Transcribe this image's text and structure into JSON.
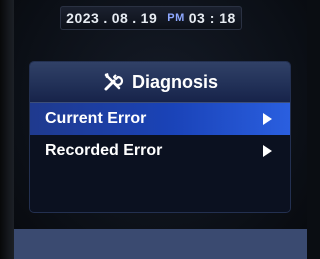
{
  "status_bar": {
    "year": "2023",
    "month": "08",
    "day": "19",
    "ampm": "PM",
    "time": "03 : 18",
    "separator": "."
  },
  "diagnosis_menu": {
    "title": "Diagnosis",
    "title_icon": "tools-icon",
    "items": [
      {
        "label": "Current Error",
        "selected": true,
        "arrow_icon": "right-triangle-icon"
      },
      {
        "label": "Recorded Error",
        "selected": false,
        "arrow_icon": "right-triangle-icon"
      }
    ]
  },
  "colors": {
    "header": "#223158",
    "selected_item": "#1a43b8",
    "ampm_text": "#8ea8ff"
  }
}
